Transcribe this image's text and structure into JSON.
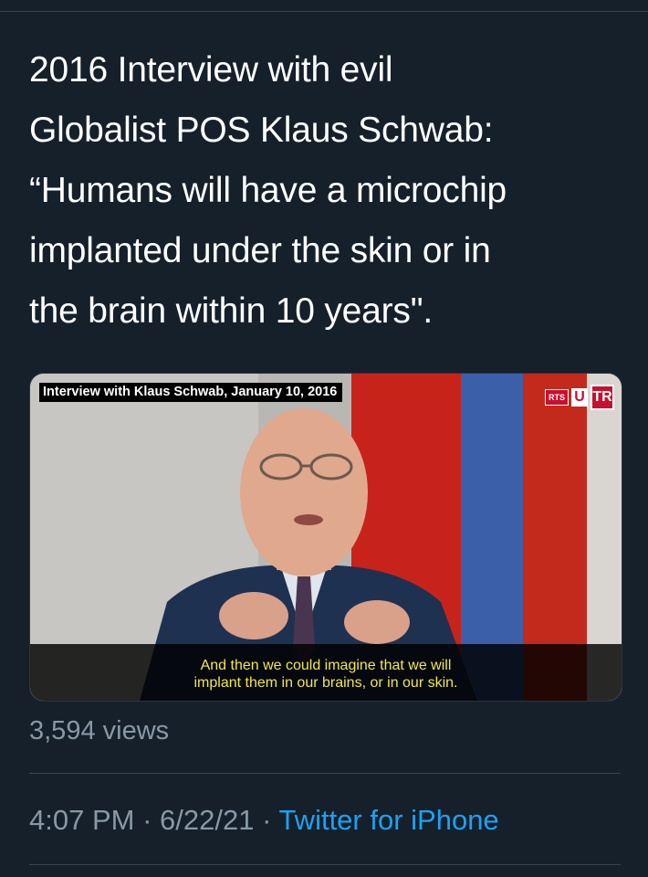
{
  "tweet": {
    "text": "2016 Interview with evil\nGlobalist POS Klaus Schwab:\n“Humans will have a microchip\nimplanted under the skin or in\nthe brain within 10 years\"."
  },
  "media": {
    "caption_top": "Interview with Klaus Schwab, January 10, 2016",
    "logo_rts": "RTS",
    "logo_u": "U",
    "logo_tr": "TR",
    "subtitle": "And then we could imagine that we will\nimplant them in our brains, or in our skin."
  },
  "stats": {
    "views": "3,594 views"
  },
  "meta": {
    "time": "4:07 PM",
    "separator1": " · ",
    "date": "6/22/21",
    "separator2": " · ",
    "source": "Twitter for iPhone"
  },
  "colors": {
    "background": "#15202b",
    "text": "#ffffff",
    "muted": "#8899a6",
    "link": "#1da1f2",
    "subtitle": "#f2e74c"
  }
}
